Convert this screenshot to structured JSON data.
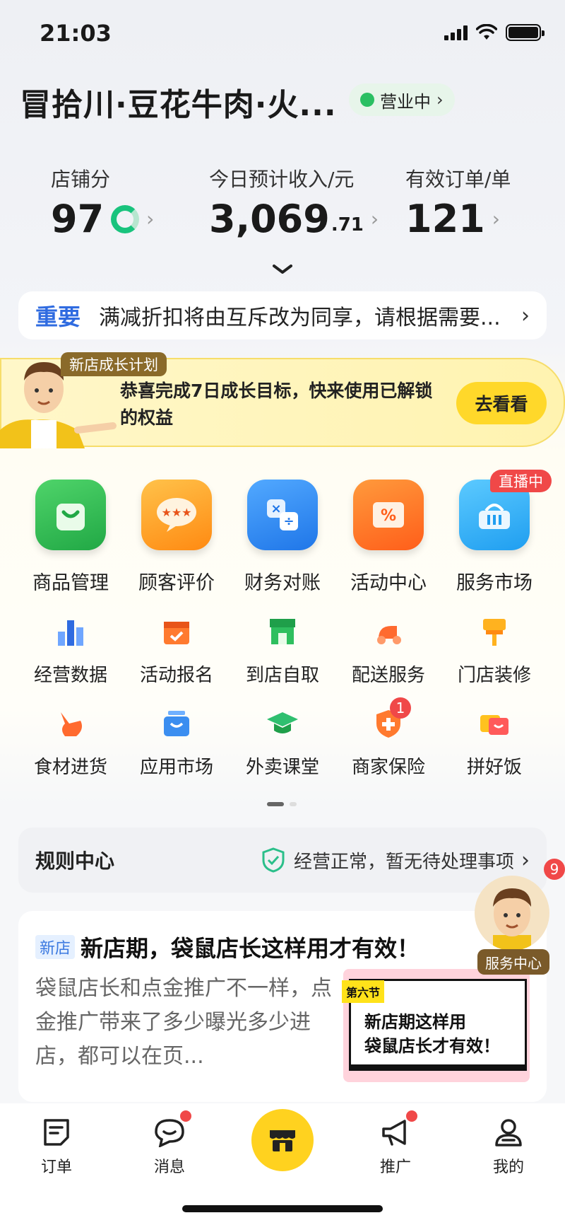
{
  "status_bar": {
    "time": "21:03"
  },
  "header": {
    "store_name": "冒拾川·豆花牛肉·火...",
    "status": "营业中"
  },
  "metrics": [
    {
      "label": "店铺分",
      "value": "97"
    },
    {
      "label": "今日预计收入/元",
      "value": "3,069",
      "decimal": ".71"
    },
    {
      "label": "有效订单/单",
      "value": "121"
    }
  ],
  "notice": {
    "tag": "重要",
    "text": "满减折扣将由互斥改为同享，请根据需要..."
  },
  "growth": {
    "tag": "新店成长计划",
    "text": "恭喜完成7日成长目标，快来使用已解锁的权益",
    "button": "去看看"
  },
  "main_tools": [
    {
      "label": "商品管理",
      "icon": "shopping-bag-icon",
      "color": "#2fbf4f"
    },
    {
      "label": "顾客评价",
      "icon": "review-bubble-icon",
      "color": "#ff9e1b"
    },
    {
      "label": "财务对账",
      "icon": "calculator-icon",
      "color": "#2f8ef0"
    },
    {
      "label": "活动中心",
      "icon": "coupon-icon",
      "color": "#ff7a1f"
    },
    {
      "label": "服务市场",
      "icon": "basket-icon",
      "color": "#2faef0",
      "badge": "直播中"
    }
  ],
  "tools": [
    {
      "label": "经营数据",
      "icon": "bar-chart-icon",
      "color": "#3b7bf0"
    },
    {
      "label": "活动报名",
      "icon": "calendar-icon",
      "color": "#ff7a2f"
    },
    {
      "label": "到店自取",
      "icon": "storefront-icon",
      "color": "#2fbf5f"
    },
    {
      "label": "配送服务",
      "icon": "scooter-icon",
      "color": "#ff6a2f"
    },
    {
      "label": "门店装修",
      "icon": "paint-brush-icon",
      "color": "#ffb21f"
    },
    {
      "label": "食材进货",
      "icon": "kangaroo-icon",
      "color": "#ff6a2f"
    },
    {
      "label": "应用市场",
      "icon": "app-box-icon",
      "color": "#3b8ef0"
    },
    {
      "label": "外卖课堂",
      "icon": "graduation-cap-icon",
      "color": "#2fbf6f"
    },
    {
      "label": "商家保险",
      "icon": "shield-plus-icon",
      "color": "#ff7a2f",
      "badge": "1"
    },
    {
      "label": "拼好饭",
      "icon": "lunchbox-icon",
      "color": "#ffc21f"
    }
  ],
  "rules": {
    "title": "规则中心",
    "status": "经营正常，暂无待处理事项"
  },
  "article": {
    "tag": "新店",
    "title": "新店期，袋鼠店长这样用才有效！",
    "body": "袋鼠店长和点金推广不一样，点金推广带来了多少曝光多少进店，都可以在页...",
    "thumb_tag": "第六节",
    "thumb_text": "新店期这样用\n袋鼠店长才有效！"
  },
  "service": {
    "label": "服务中心",
    "badge": "9"
  },
  "tabbar": [
    {
      "label": "订单",
      "icon": "order-icon"
    },
    {
      "label": "消息",
      "icon": "message-icon",
      "dot": true
    },
    {
      "label": "",
      "icon": "store-center-icon"
    },
    {
      "label": "推广",
      "icon": "megaphone-icon",
      "dot": true
    },
    {
      "label": "我的",
      "icon": "profile-icon"
    }
  ]
}
